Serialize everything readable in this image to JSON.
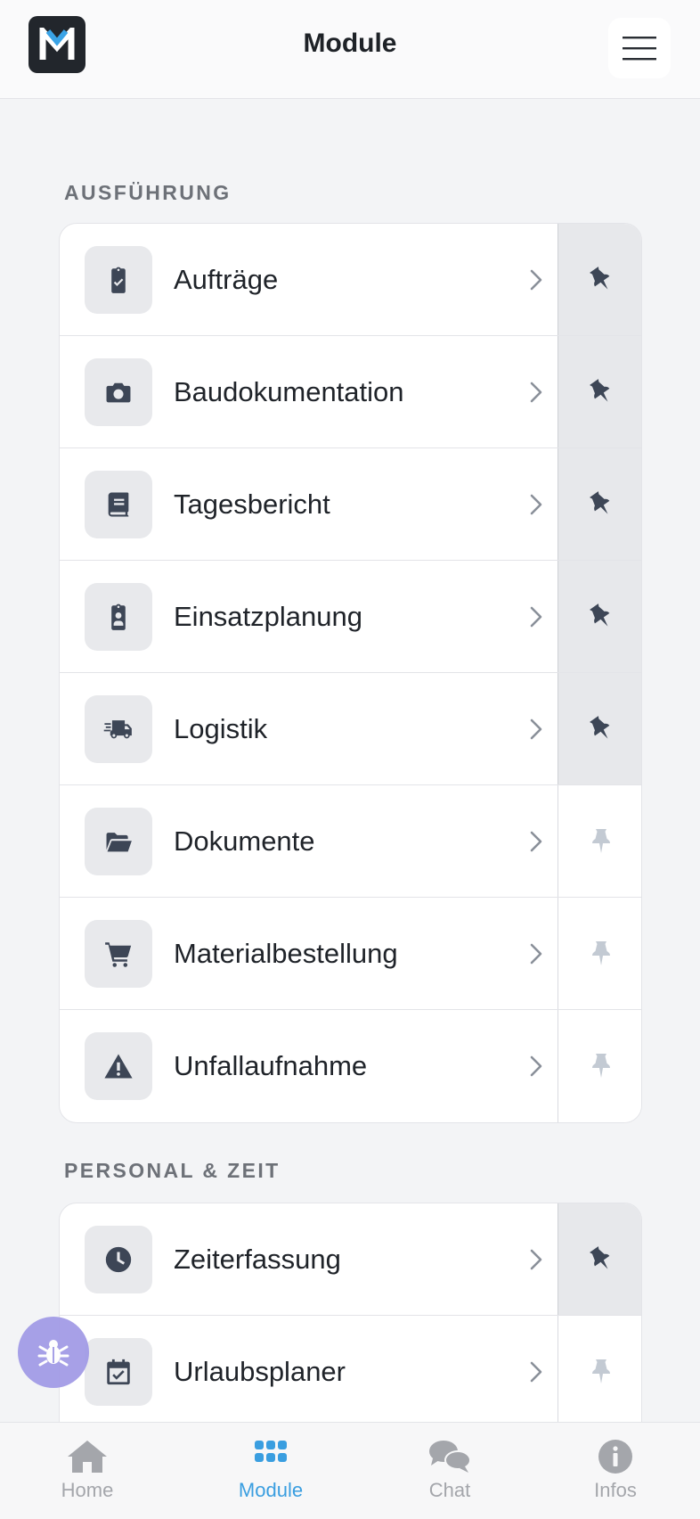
{
  "header": {
    "title": "Module",
    "logo_letter": "M"
  },
  "sections": [
    {
      "label": "AUSFÜHRUNG",
      "items": [
        {
          "label": "Aufträge",
          "icon": "clipboard-check-icon",
          "pinned": true
        },
        {
          "label": "Baudokumentation",
          "icon": "camera-icon",
          "pinned": true
        },
        {
          "label": "Tagesbericht",
          "icon": "book-icon",
          "pinned": true
        },
        {
          "label": "Einsatzplanung",
          "icon": "clipboard-user-icon",
          "pinned": true
        },
        {
          "label": "Logistik",
          "icon": "truck-fast-icon",
          "pinned": true
        },
        {
          "label": "Dokumente",
          "icon": "folder-open-icon",
          "pinned": false
        },
        {
          "label": "Materialbestellung",
          "icon": "cart-icon",
          "pinned": false
        },
        {
          "label": "Unfallaufnahme",
          "icon": "warning-icon",
          "pinned": false
        }
      ]
    },
    {
      "label": "PERSONAL & ZEIT",
      "items": [
        {
          "label": "Zeiterfassung",
          "icon": "clock-icon",
          "pinned": true
        },
        {
          "label": "Urlaubsplaner",
          "icon": "calendar-check-icon",
          "pinned": false
        }
      ]
    }
  ],
  "bottom_nav": [
    {
      "label": "Home",
      "icon": "home-icon",
      "active": false
    },
    {
      "label": "Module",
      "icon": "grid-icon",
      "active": true
    },
    {
      "label": "Chat",
      "icon": "chat-icon",
      "active": false
    },
    {
      "label": "Infos",
      "icon": "info-icon",
      "active": false
    }
  ],
  "colors": {
    "accent": "#3a9ee0",
    "pinned_bg": "#e7e8eb",
    "icon": "#3d4656",
    "debug_fab": "#a099e6"
  }
}
